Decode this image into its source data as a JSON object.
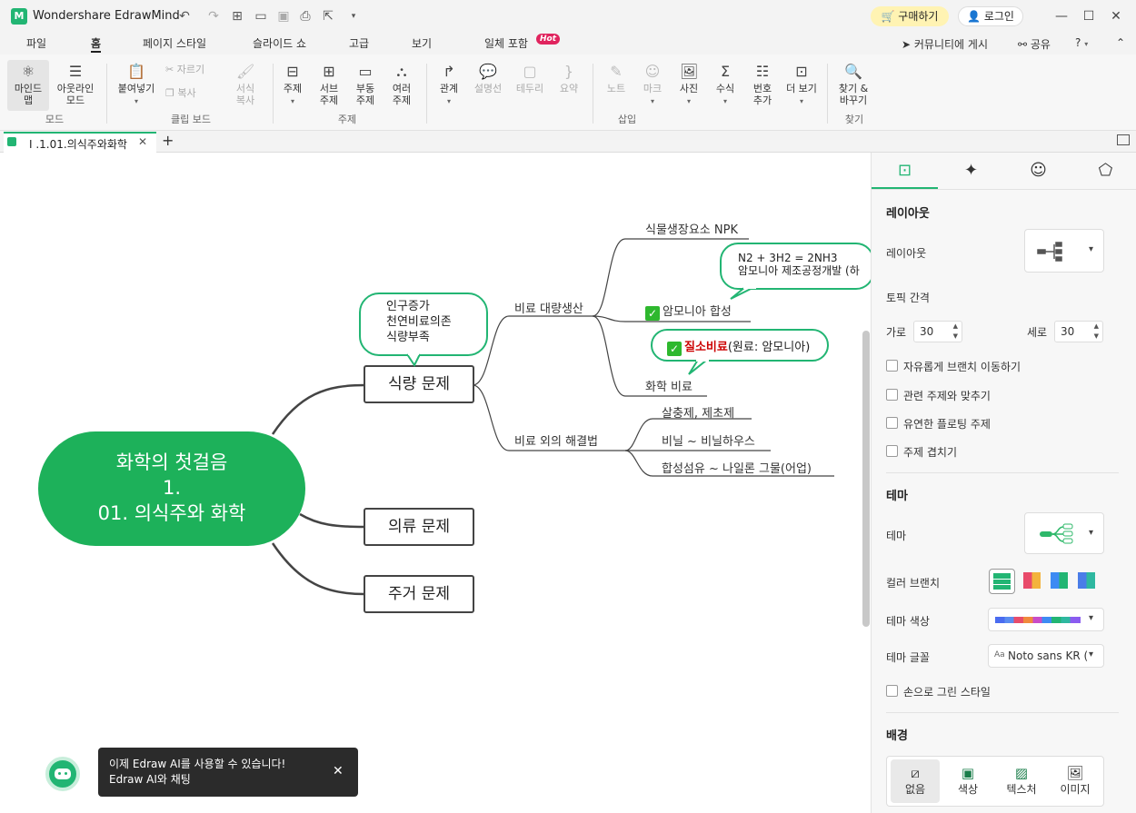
{
  "app": {
    "title": "Wondershare EdrawMind",
    "logo": "M"
  },
  "titlebar": {
    "buy": "구매하기",
    "login": "로그인"
  },
  "menu": {
    "tabs": [
      "파일",
      "홈",
      "페이지 스타일",
      "슬라이드 쇼",
      "고급",
      "보기",
      "일체 포함"
    ],
    "hot": "Hot",
    "community": "커뮤니티에 게시",
    "share": "공유"
  },
  "ribbon": {
    "mindmap": "마인드\n맵",
    "outline": "아웃라인\n모드",
    "mode_group": "모드",
    "paste": "붙여넣기",
    "cut": "자르기",
    "copy": "복사",
    "format_copy": "서식\n복사",
    "clipboard_group": "클립 보드",
    "topic": "주제",
    "subtopic": "서브\n주제",
    "floating": "부동\n주제",
    "multi": "여러\n주제",
    "topic_group": "주제",
    "relation": "관계",
    "callout": "설명선",
    "boundary": "테두리",
    "summary": "요약",
    "note": "노트",
    "mark": "마크",
    "photo": "사진",
    "formula": "수식",
    "numbering": "번호\n추가",
    "more": "더 보기",
    "insert_group": "삽입",
    "find": "찾기 &\n바꾸기",
    "find_group": "찾기"
  },
  "doc": {
    "tab": "I .1.01.의식주와화학"
  },
  "mindmap": {
    "root": [
      "화학의 첫걸음",
      "1.",
      "01. 의식주와 화학"
    ],
    "food": "식량 문제",
    "clothing": "의류 문제",
    "housing": "주거 문제",
    "callout_food": [
      "인구증가",
      "천연비료의존",
      "식량부족"
    ],
    "branch1": "비료 대량생산",
    "branch2": "비료 외의 해결법",
    "npk": "식물생장요소 NPK",
    "eq_callout": [
      "N2 + 3H2 = 2NH3",
      "암모니아 제조공정개발 (하"
    ],
    "ammonia": "암모니아 합성",
    "nitrate_bold": "질소비료",
    "nitrate_rest": "(원료: 암모니아)",
    "chem_fert": "화학 비료",
    "pesticide": "살충제, 제초제",
    "vinyl": "비닐 ~ 비닐하우스",
    "fiber": "합성섬유 ~ 나일론 그물(어업)"
  },
  "panel": {
    "layout_section": "레이아웃",
    "layout_label": "레이아웃",
    "spacing": "토픽 간격",
    "horizontal": "가로",
    "horizontal_val": "30",
    "vertical": "세로",
    "vertical_val": "30",
    "cb1": "자유롭게 브랜치 이동하기",
    "cb2": "관련 주제와 맞추기",
    "cb3": "유연한 플로팅 주제",
    "cb4": "주제 겹치기",
    "theme_section": "테마",
    "theme_label": "테마",
    "color_branch": "컬러 브랜치",
    "theme_color": "테마 색상",
    "theme_font": "테마 글꼴",
    "font_value": "Noto sans KR (",
    "hand_style": "손으로 그린 스타일",
    "bg_section": "배경",
    "bg_none": "없음",
    "bg_color": "색상",
    "bg_texture": "텍스처",
    "bg_image": "이미지"
  },
  "toast": {
    "text": "이제 Edraw AI를 사용할 수 있습니다! Edraw AI와 채팅"
  },
  "colors": {
    "accent": "#22b573",
    "root": "#1db15a"
  }
}
